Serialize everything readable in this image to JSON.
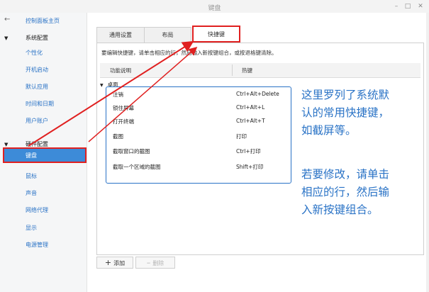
{
  "window": {
    "title": "键盘"
  },
  "sidebar": {
    "home": "控制面板主页",
    "groups": [
      {
        "label": "系统配置",
        "items": [
          "个性化",
          "开机启动",
          "默认应用",
          "时间和日期",
          "用户账户"
        ]
      },
      {
        "label": "硬件配置",
        "items": [
          "键盘",
          "鼠标",
          "声音",
          "网络代理",
          "显示",
          "电源管理"
        ]
      }
    ],
    "active_item": "键盘"
  },
  "tabs": [
    {
      "label": "通用设置",
      "active": false
    },
    {
      "label": "布局",
      "active": false
    },
    {
      "label": "快捷键",
      "active": true
    }
  ],
  "shortcuts": {
    "hint": "要编辑快捷键，请单击相应的行，然后输入新按键组合，或按退格键清除。",
    "col_action": "功能说明",
    "col_key": "热键",
    "category": "桌面",
    "rows": [
      {
        "action": "注销",
        "key": "Ctrl+Alt+Delete"
      },
      {
        "action": "锁住屏幕",
        "key": "Ctrl+Alt+L"
      },
      {
        "action": "打开终端",
        "key": "Ctrl+Alt+T"
      },
      {
        "action": "截图",
        "key": "打印"
      },
      {
        "action": "截取窗口的截图",
        "key": "Ctrl+打印"
      },
      {
        "action": "截取一个区域的截图",
        "key": "Shift+打印"
      }
    ]
  },
  "buttons": {
    "add": "添加",
    "remove": "删除"
  },
  "annotations": {
    "line1": "这里罗列了系统默",
    "line2": "认的常用快捷键，",
    "line3": "如截屏等。",
    "line4": "若要修改，请单击",
    "line5": "相应的行，然后输",
    "line6": "入新按键组合。"
  },
  "colors": {
    "accent": "#2a73c6",
    "highlight_red": "#e02020",
    "active_bg": "#3d8bd8"
  }
}
